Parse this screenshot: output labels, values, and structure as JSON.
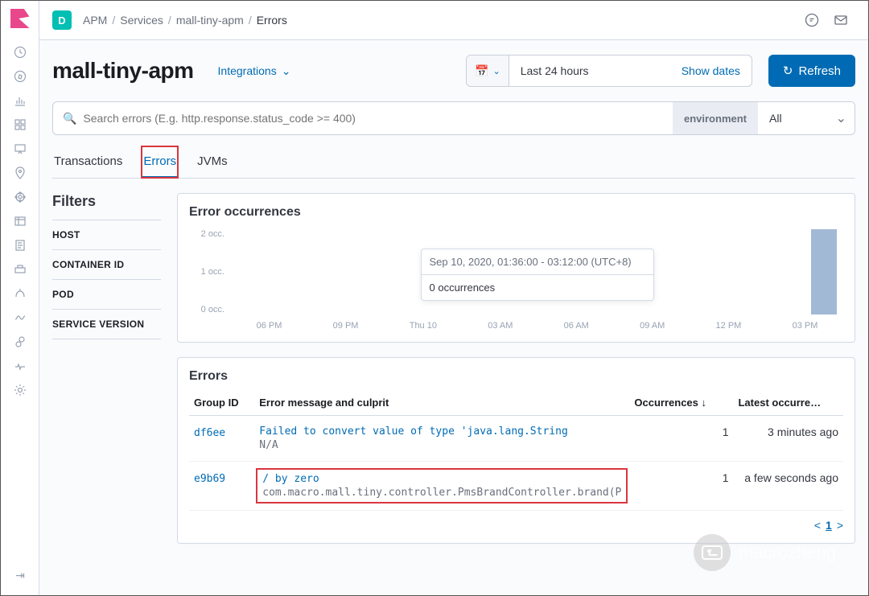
{
  "space_initial": "D",
  "breadcrumb": {
    "items": [
      "APM",
      "Services",
      "mall-tiny-apm"
    ],
    "current": "Errors"
  },
  "title": "mall-tiny-apm",
  "integrations_label": "Integrations",
  "date_picker": {
    "range_label": "Last 24 hours",
    "show_dates": "Show dates"
  },
  "refresh_label": "Refresh",
  "search": {
    "placeholder": "Search errors (E.g. http.response.status_code >= 400)"
  },
  "environment": {
    "label": "environment",
    "value": "All"
  },
  "tabs": [
    "Transactions",
    "Errors",
    "JVMs"
  ],
  "active_tab": "Errors",
  "filters": {
    "heading": "Filters",
    "items": [
      "HOST",
      "CONTAINER ID",
      "POD",
      "SERVICE VERSION"
    ]
  },
  "occ_panel": {
    "title": "Error occurrences",
    "tooltip_time": "Sep 10, 2020, 01:36:00 - 03:12:00 (UTC+8)",
    "tooltip_value": "0 occurrences"
  },
  "chart_data": {
    "type": "bar",
    "title": "Error occurrences",
    "xlabel": "",
    "ylabel": "occurrences",
    "yticks": [
      "2 occ.",
      "1 occ.",
      "0 occ."
    ],
    "ylim": [
      0,
      2
    ],
    "categories": [
      "06 PM",
      "09 PM",
      "Thu 10",
      "03 AM",
      "06 AM",
      "09 AM",
      "12 PM",
      "03 PM"
    ],
    "values": [
      0,
      0,
      0,
      0,
      0,
      0,
      0,
      2
    ]
  },
  "errors_panel": {
    "title": "Errors",
    "columns": {
      "group": "Group ID",
      "msg": "Error message and culprit",
      "occ": "Occurrences",
      "latest": "Latest occurre…"
    },
    "rows": [
      {
        "group_id": "df6ee",
        "message": "Failed to convert value of type 'java.lang.String",
        "culprit": "N/A",
        "occurrences": 1,
        "latest": "3 minutes ago",
        "hl": false
      },
      {
        "group_id": "e9b69",
        "message": "/ by zero",
        "culprit": "com.macro.mall.tiny.controller.PmsBrandController.brand(P",
        "occurrences": 1,
        "latest": "a few seconds ago",
        "hl": true
      }
    ],
    "page": "1"
  },
  "watermark": "macrozheng"
}
